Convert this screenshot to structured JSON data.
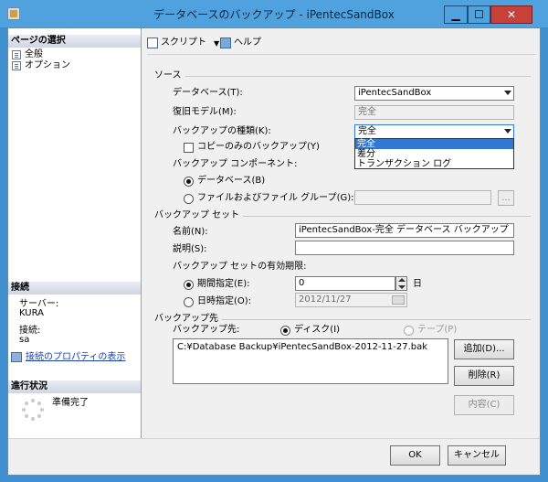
{
  "window": {
    "title": "データベースのバックアップ - iPentecSandBox",
    "min_glyph": "▁",
    "max_glyph": "☐",
    "close_glyph": "✕"
  },
  "left_pane": {
    "select_page_title": "ページの選択",
    "pages": [
      "全般",
      "オプション"
    ],
    "connection_title": "接続",
    "server_label": "サーバー:",
    "server_value": "KURA",
    "connection_label": "接続:",
    "connection_value": "sa",
    "view_props_link": "接続のプロパティの表示",
    "progress_title": "進行状況",
    "progress_status": "準備完了"
  },
  "toolbar": {
    "script_label": "スクリプト",
    "help_label": "ヘルプ"
  },
  "source": {
    "group_title": "ソース",
    "database_label": "データベース(T):",
    "database_value": "iPentecSandBox",
    "recovery_label": "復旧モデル(M):",
    "recovery_value": "完全",
    "backup_type_label": "バックアップの種類(K):",
    "backup_type_value": "完全",
    "backup_type_options": [
      "完全",
      "差分",
      "トランザクション ログ"
    ],
    "copy_only_label": "コピーのみのバックアップ(Y)",
    "component_label": "バックアップ コンポーネント:",
    "component_database": "データベース(B)",
    "component_files": "ファイルおよびファイル グループ(G):",
    "files_browse": "..."
  },
  "backup_set": {
    "group_title": "バックアップ セット",
    "name_label": "名前(N):",
    "name_value": "iPentecSandBox-完全 データベース バックアップ",
    "desc_label": "説明(S):",
    "desc_value": "",
    "expire_label": "バックアップ セットの有効期限:",
    "after_label": "期間指定(E):",
    "after_value": "0",
    "after_unit": "日",
    "on_label": "日時指定(O):",
    "on_value": "2012/11/27"
  },
  "destination": {
    "group_title": "バックアップ先",
    "dest_label": "バックアップ先:",
    "disk_label": "ディスク(I)",
    "tape_label": "テープ(P)",
    "paths": [
      "C:¥Database Backup¥iPentecSandBox-2012-11-27.bak"
    ],
    "add_button": "追加(D)...",
    "remove_button": "削除(R)",
    "contents_button": "内容(C)"
  },
  "footer": {
    "ok_button": "OK",
    "cancel_button": "キャンセル"
  }
}
